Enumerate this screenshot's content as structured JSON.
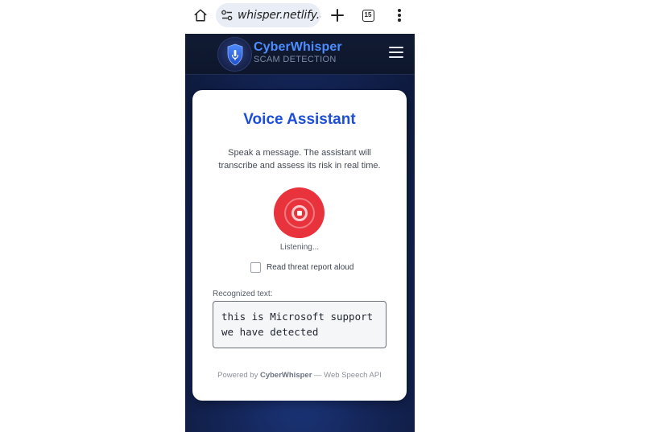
{
  "browser": {
    "url": "whisper.netlify.app",
    "tab_count": "15"
  },
  "header": {
    "brand_name": "CyberWhisper",
    "tagline": "SCAM DETECTION"
  },
  "card": {
    "title": "Voice Assistant",
    "description": "Speak a message. The assistant will transcribe and assess its risk in real time.",
    "mic_state": "recording",
    "status": "Listening...",
    "read_aloud_label": "Read threat report aloud",
    "read_aloud_checked": false,
    "recognized_label": "Recognized text:",
    "recognized_text": "this is Microsoft support\nwe have detected",
    "footer_prefix": "Powered by",
    "footer_brand": "CyberWhisper",
    "footer_suffix": "— Web Speech API"
  },
  "colors": {
    "accent": "#1d4ed8",
    "brand": "#4d8dff",
    "record": "#e8323c",
    "page_bg": "#15275c"
  },
  "icons": {
    "home": "home-icon",
    "site_settings": "tune-icon",
    "new_tab": "plus-icon",
    "tabs": "tab-switcher-icon",
    "browser_menu": "more-vert-icon",
    "logo": "shield-mic-icon",
    "site_menu": "hamburger-icon",
    "record": "stop-recording-icon"
  }
}
